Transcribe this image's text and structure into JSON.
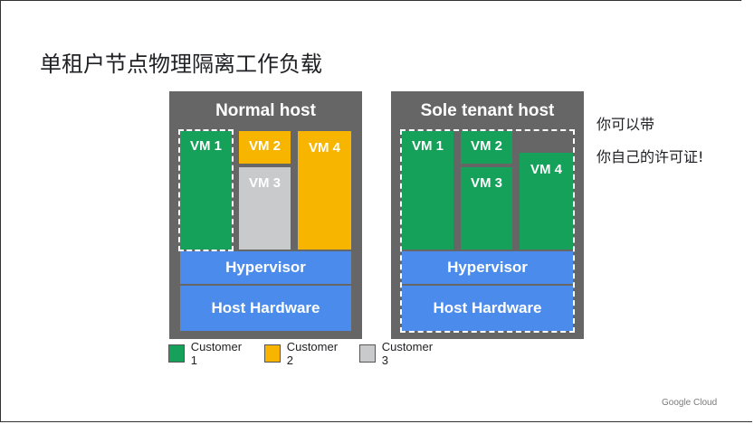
{
  "slide": {
    "title": "单租户节点物理隔离工作负载",
    "brand": "Google Cloud"
  },
  "note": {
    "line1": "你可以带",
    "line2": "你自己的许可证!"
  },
  "normal_host": {
    "title": "Normal host",
    "vm1": "VM 1",
    "vm2": "VM 2",
    "vm3": "VM 3",
    "vm4": "VM 4",
    "hypervisor": "Hypervisor",
    "hardware": "Host Hardware"
  },
  "sole_host": {
    "title": "Sole tenant host",
    "vm1": "VM 1",
    "vm2": "VM 2",
    "vm3": "VM 3",
    "vm4": "VM 4",
    "hypervisor": "Hypervisor",
    "hardware": "Host Hardware"
  },
  "legend": {
    "items": [
      {
        "label": "Customer 1",
        "color": "#16a15a"
      },
      {
        "label": "Customer 2",
        "color": "#f7b500"
      },
      {
        "label": "Customer 3",
        "color": "#c8cacb"
      }
    ]
  }
}
